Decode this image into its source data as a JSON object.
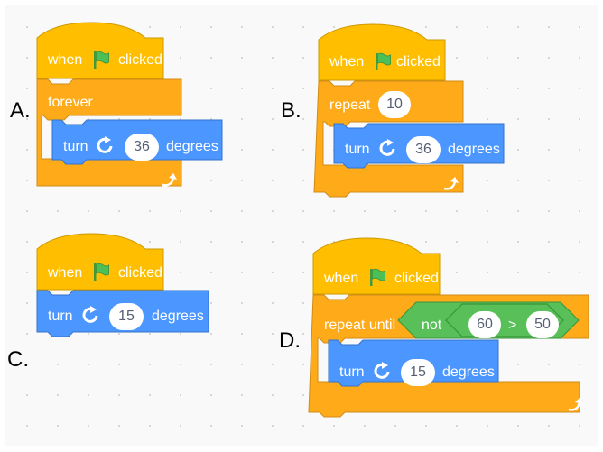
{
  "labels": {
    "a": "A.",
    "b": "B.",
    "c": "C.",
    "d": "D."
  },
  "hat": {
    "when": "when",
    "clicked": "clicked"
  },
  "a": {
    "loop": "forever",
    "turn": "turn",
    "degrees": "36",
    "unit": "degrees"
  },
  "b": {
    "loop": "repeat",
    "times": "10",
    "turn": "turn",
    "degrees": "36",
    "unit": "degrees"
  },
  "c": {
    "turn": "turn",
    "degrees": "15",
    "unit": "degrees"
  },
  "d": {
    "loop": "repeat until",
    "not": "not",
    "left": "60",
    "op": ">",
    "right": "50",
    "turn": "turn",
    "degrees": "15",
    "unit": "degrees"
  },
  "icons": [
    "green-flag-icon",
    "rotate-right-icon",
    "loop-arrow-icon"
  ],
  "colors": {
    "events": "#ffbf00",
    "control": "#ffab19",
    "motion": "#4c97ff",
    "operators": "#59c059",
    "flag": "#4cbf56"
  }
}
